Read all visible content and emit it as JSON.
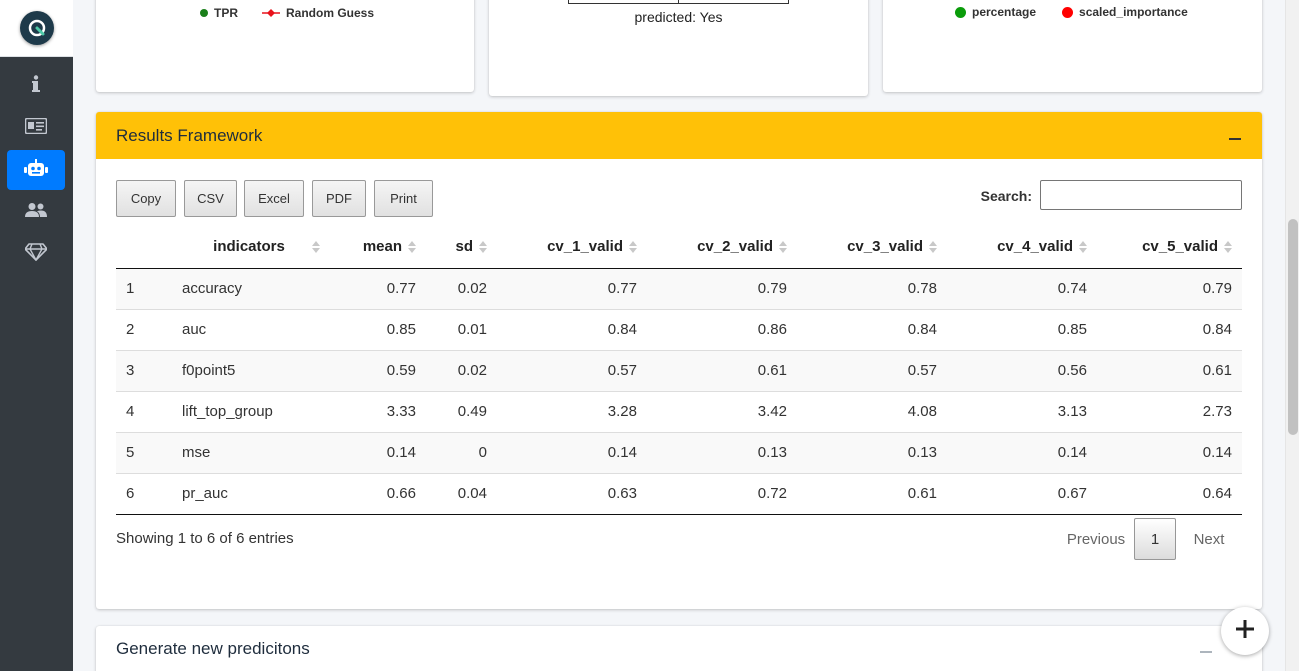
{
  "top_cards": {
    "roc_legend": [
      {
        "label": "TPR",
        "color": "#1a7f1a"
      },
      {
        "label": "Random Guess",
        "color": "#e8121b"
      }
    ],
    "confusion_caption": "predicted: Yes",
    "importance_legend": [
      {
        "label": "percentage",
        "color": "#0a9c0a"
      },
      {
        "label": "scaled_importance",
        "color": "#ff0000"
      }
    ]
  },
  "results": {
    "title": "Results Framework",
    "buttons": {
      "copy": "Copy",
      "csv": "CSV",
      "excel": "Excel",
      "pdf": "PDF",
      "print": "Print"
    },
    "search_label": "Search:",
    "search_value": "",
    "columns": [
      "indicators",
      "mean",
      "sd",
      "cv_1_valid",
      "cv_2_valid",
      "cv_3_valid",
      "cv_4_valid",
      "cv_5_valid"
    ],
    "rows": [
      {
        "num": "1",
        "cells": [
          "accuracy",
          "0.77",
          "0.02",
          "0.77",
          "0.79",
          "0.78",
          "0.74",
          "0.79"
        ]
      },
      {
        "num": "2",
        "cells": [
          "auc",
          "0.85",
          "0.01",
          "0.84",
          "0.86",
          "0.84",
          "0.85",
          "0.84"
        ]
      },
      {
        "num": "3",
        "cells": [
          "f0point5",
          "0.59",
          "0.02",
          "0.57",
          "0.61",
          "0.57",
          "0.56",
          "0.61"
        ]
      },
      {
        "num": "4",
        "cells": [
          "lift_top_group",
          "3.33",
          "0.49",
          "3.28",
          "3.42",
          "4.08",
          "3.13",
          "2.73"
        ]
      },
      {
        "num": "5",
        "cells": [
          "mse",
          "0.14",
          "0",
          "0.14",
          "0.13",
          "0.13",
          "0.14",
          "0.14"
        ]
      },
      {
        "num": "6",
        "cells": [
          "pr_auc",
          "0.66",
          "0.04",
          "0.63",
          "0.72",
          "0.61",
          "0.67",
          "0.64"
        ]
      }
    ],
    "info": "Showing 1 to 6 of 6 entries",
    "pagination": {
      "previous": "Previous",
      "current": "1",
      "next": "Next"
    }
  },
  "generate": {
    "title": "Generate new predicitons"
  },
  "colors": {
    "header_bg": "#ffc107",
    "sidebar_bg": "#343a40",
    "active_nav": "#007bff"
  }
}
